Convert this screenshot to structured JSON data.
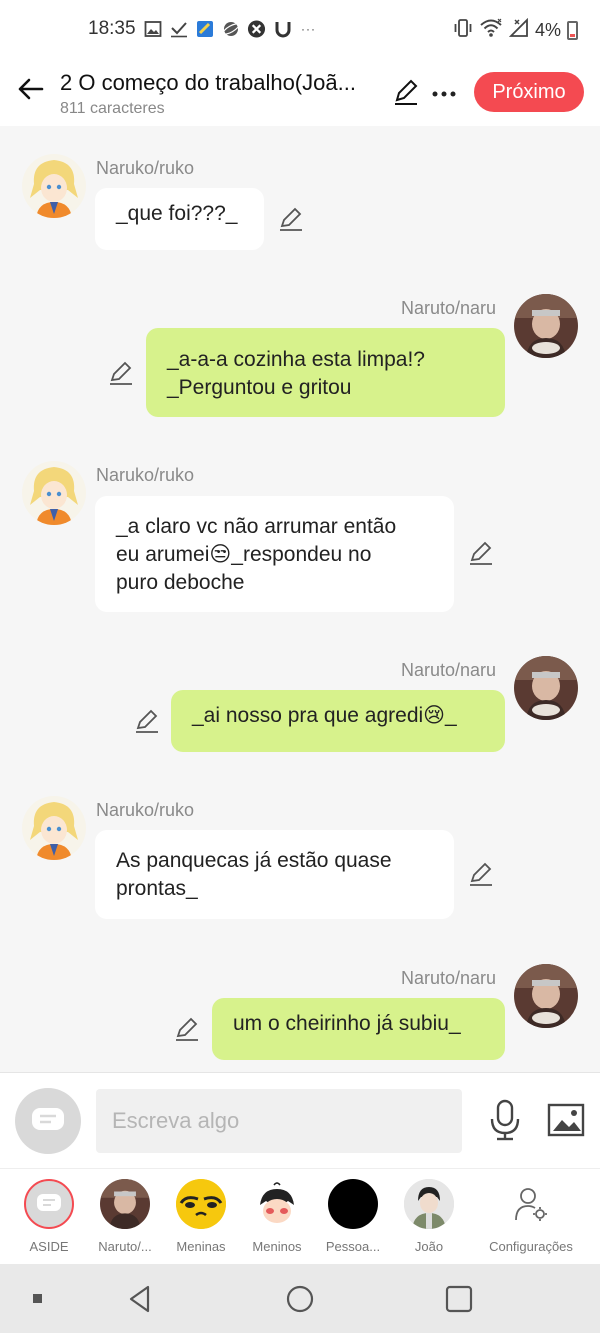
{
  "status": {
    "time": "18:35",
    "battery": "4%",
    "icons_left": [
      "gallery-icon",
      "check-icon",
      "app-icon",
      "globe-icon",
      "xbox-icon",
      "u-icon",
      "more-dots-icon"
    ],
    "icons_right": [
      "vibrate-icon",
      "wifi-icon",
      "signal-icon",
      "battery-icon"
    ]
  },
  "header": {
    "title": "2 O começo do trabalho(Joã...",
    "subtitle": "811 caracteres",
    "next_label": "Próximo",
    "accent": "#f44a51"
  },
  "messages": [
    {
      "side": "left",
      "name": "Naruko/ruko",
      "lines": [
        "_que foi???_"
      ]
    },
    {
      "side": "right",
      "name": "Naruto/naru",
      "lines": [
        "_a-a-a cozinha esta limpa!?",
        "_Perguntou e gritou"
      ]
    },
    {
      "side": "left",
      "name": "Naruko/ruko",
      "lines": [
        "_a claro vc não arrumar então",
        "eu arumei😒_respondeu no",
        "puro deboche"
      ]
    },
    {
      "side": "right",
      "name": "Naruto/naru",
      "lines": [
        "_ai nosso pra que agredi😢_"
      ]
    },
    {
      "side": "left",
      "name": "Naruko/ruko",
      "lines": [
        "As panquecas já estão quase",
        "prontas_"
      ]
    },
    {
      "side": "right",
      "name": "Naruto/naru",
      "lines": [
        "um o cheirinho já subiu_"
      ]
    }
  ],
  "input": {
    "placeholder": "Escreva algo"
  },
  "characters": [
    {
      "label": "ASIDE"
    },
    {
      "label": "Naruto/..."
    },
    {
      "label": "Meninas"
    },
    {
      "label": "Meninos"
    },
    {
      "label": "Pessoa..."
    },
    {
      "label": "João"
    },
    {
      "label": "Configurações"
    }
  ],
  "colors": {
    "bubble_left": "#ffffff",
    "bubble_right": "#d7f28c",
    "background": "#f6f6f6"
  }
}
